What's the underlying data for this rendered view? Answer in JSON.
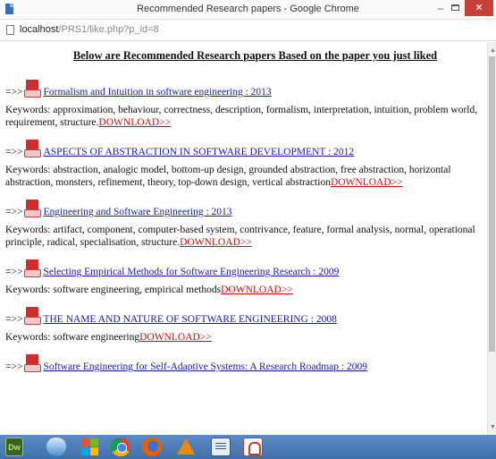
{
  "window": {
    "title": "Recommended Research papers - Google Chrome",
    "minimize_glyph": "–",
    "close_glyph": "×"
  },
  "address": {
    "host": "localhost",
    "path": "/PRS1/like.php?p_id=8"
  },
  "page": {
    "heading": "Below are Recommended Research papers Based on the paper you just liked",
    "arrow": "=>>",
    "download_label": "DOWNLOAD>>",
    "papers": [
      {
        "title": "Formalism and Intuition in software engineering : 2013",
        "keywords": "Keywords: approximation, behaviour, correctness, description, formalism, interpretation, intuition, problem world, requirement, structure."
      },
      {
        "title": "ASPECTS OF ABSTRACTION IN SOFTWARE DEVELOPMENT : 2012",
        "keywords": "Keywords: abstraction, analogic model, bottom-up design, grounded abstraction, free abstraction, horizontal abstraction, monsters, refinement, theory, top-down design, vertical abstraction"
      },
      {
        "title": "Engineering and Software Engineering : 2013",
        "keywords": "Keywords: artifact, component, computer-based system, contrivance, feature, formal analysis, normal, operational principle, radical, specialisation, structure."
      },
      {
        "title": "Selecting Empirical Methods for Software Engineering Research : 2009",
        "keywords": "Keywords: software engineering, empirical methods"
      },
      {
        "title": "THE NAME AND NATURE OF SOFTWARE ENGINEERING : 2008",
        "keywords": "Keywords: software engineering"
      },
      {
        "title": "Software Engineering for Self-Adaptive Systems: A Research Roadmap : 2009",
        "keywords": ""
      }
    ]
  },
  "taskbar": {
    "dreamweaver_label": "Dw",
    "items": [
      "dreamweaver-icon",
      "shield-icon",
      "windows-logo-icon",
      "chrome-icon",
      "firefox-icon",
      "vlc-icon",
      "word-icon",
      "pdf-reader-icon"
    ]
  },
  "colors": {
    "link": "#1a1aa6",
    "download": "#cc1111",
    "close_button": "#c7413b",
    "taskbar": "#4a7db8"
  }
}
